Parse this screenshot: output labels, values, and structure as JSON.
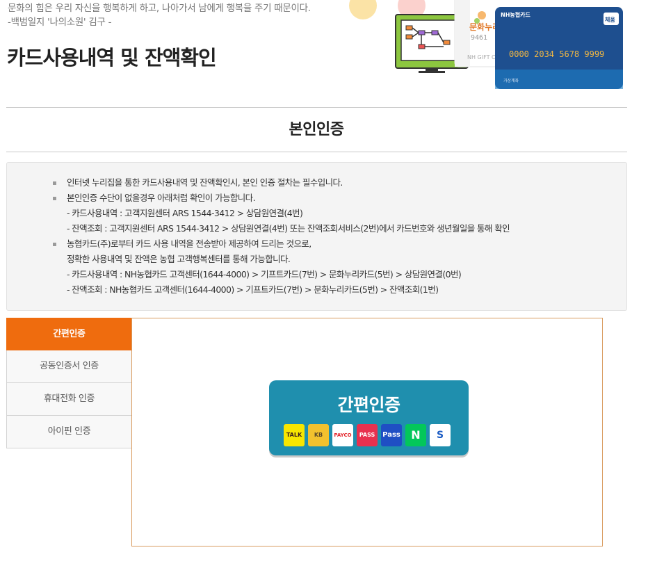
{
  "quote": {
    "line1": "문화의 힘은 우리 자신을 행복하게 하고, 나아가서 남에게 행복을 주기 때문이다.",
    "line2": "-백범일지 '나의소원' 김구 -"
  },
  "page_title": "카드사용내역 및 잔액확인",
  "hero": {
    "card_back_brand": "문화누리",
    "card_back_text": "NH GIFT CA",
    "card_back_digits": "9461",
    "card_front_brand": "NH농협카드",
    "card_front_badge": "체움",
    "card_front_number": "0000 2034 5678 9999",
    "card_front_holder": "가상계좌"
  },
  "section_title": "본인인증",
  "notice": {
    "items": [
      {
        "text": "인터넷 누리집을 통한 카드사용내역 및 잔액확인시, 본인 인증 절차는 필수입니다.",
        "subs": []
      },
      {
        "text": "본인인증 수단이 없을경우 아래처럼 확인이 가능합니다.",
        "subs": [
          "- 카드사용내역 : 고객지원센터 ARS 1544-3412 > 상담원연결(4번)",
          "- 잔액조회 : 고객지원센터 ARS 1544-3412 > 상담원연결(4번) 또는 잔액조회서비스(2번)에서 카드번호와 생년월일을 통해 확인"
        ]
      },
      {
        "text": "농협카드(주)로부터 카드 사용 내역을 전송받아 제공하여 드리는 것으로,",
        "subs": [
          "정확한 사용내역 및 잔액은 농협 고객행복센터를 통해 가능합니다.",
          "- 카드사용내역 : NH농협카드 고객센터(1644-4000) > 기프트카드(7번) > 문화누리카드(5번) > 상담원연결(0번)",
          "- 잔액조회 : NH농협카드 고객센터(1644-4000) > 기프트카드(7번) > 문화누리카드(5번) > 잔액조회(1번)"
        ]
      }
    ]
  },
  "tabs": [
    {
      "label": "간편인증",
      "active": true
    },
    {
      "label": "공동인증서 인증",
      "active": false
    },
    {
      "label": "휴대전화 인증",
      "active": false
    },
    {
      "label": "아이핀 인증",
      "active": false
    }
  ],
  "auth_button": {
    "label": "간편인증",
    "providers": [
      {
        "name": "kakao",
        "text": "TALK",
        "bg": "#f7e600",
        "fg": "#3a1d1d"
      },
      {
        "name": "kb",
        "text": "KB",
        "bg": "#f2c12e",
        "fg": "#5a4a2a"
      },
      {
        "name": "payco",
        "text": "PAYCO",
        "bg": "#ffffff",
        "fg": "#e4262c"
      },
      {
        "name": "pass",
        "text": "PASS",
        "bg": "#e8314f",
        "fg": "#ffffff"
      },
      {
        "name": "samsung-pass",
        "text": "Pass",
        "bg": "#1f4fc4",
        "fg": "#ffffff"
      },
      {
        "name": "naver",
        "text": "N",
        "bg": "#03c75a",
        "fg": "#ffffff"
      },
      {
        "name": "shinhan",
        "text": "S",
        "bg": "#ffffff",
        "fg": "#1a5bc4"
      }
    ]
  },
  "colors": {
    "accent": "#ef6c0e",
    "auth_button": "#1f8fae",
    "panel_border": "#d99b5f"
  }
}
